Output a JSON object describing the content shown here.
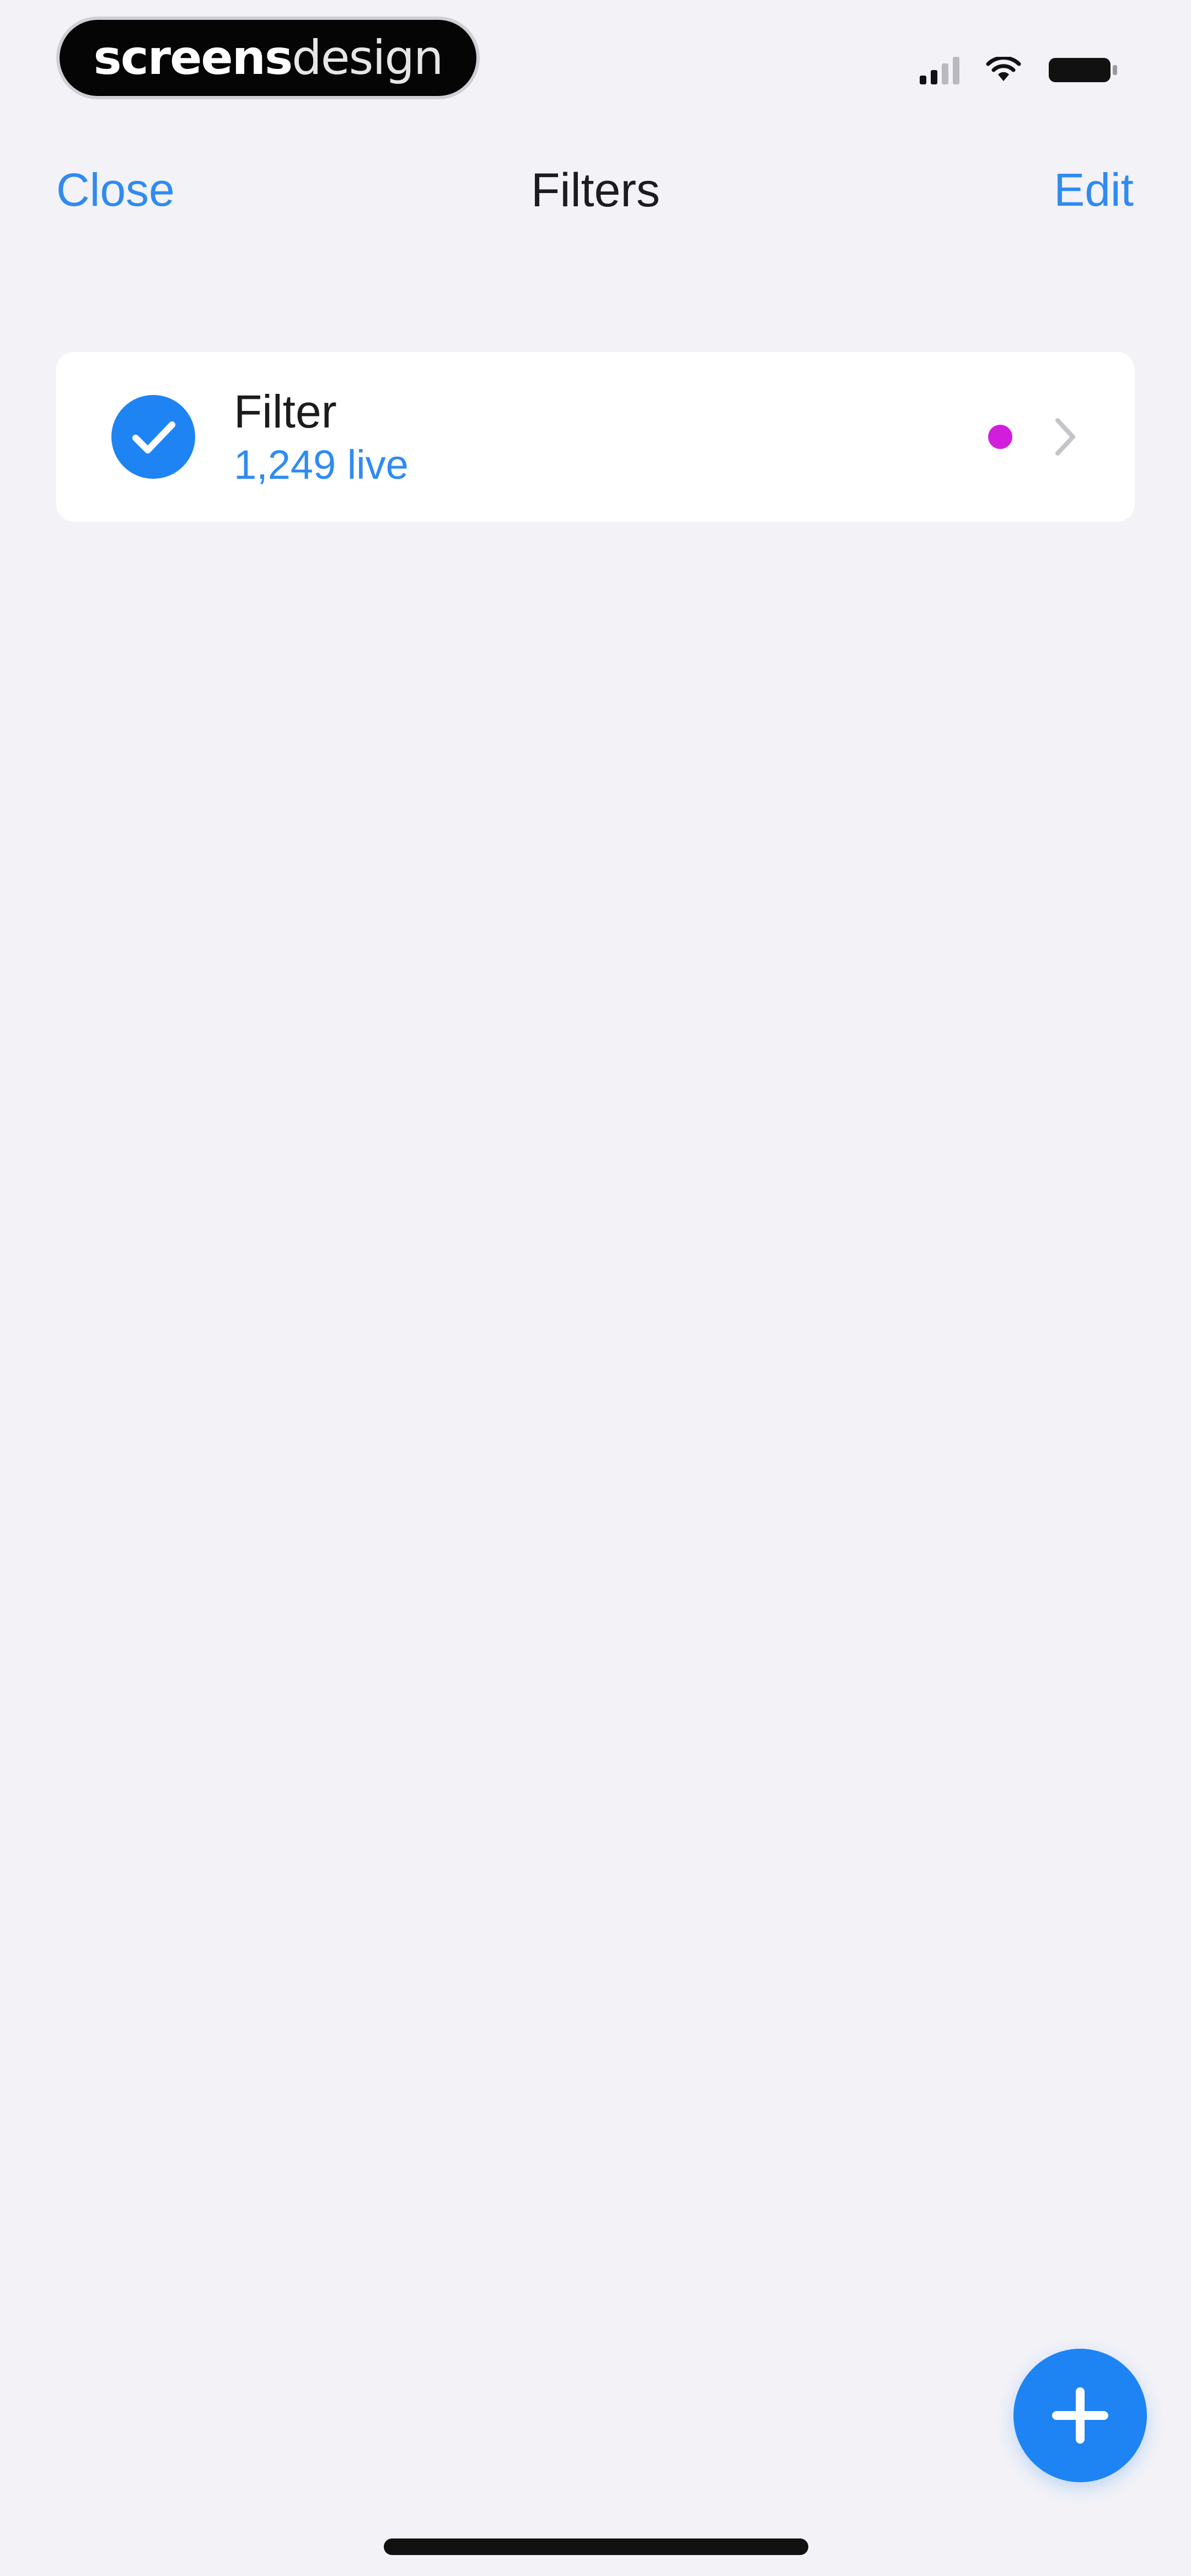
{
  "status_bar": {
    "brand_bold": "screens",
    "brand_light": "design",
    "icons": [
      "cellular-signal-icon",
      "wifi-icon",
      "battery-icon"
    ]
  },
  "nav": {
    "close_label": "Close",
    "title": "Filters",
    "edit_label": "Edit"
  },
  "filters": [
    {
      "name": "Filter",
      "count_label": "1,249 live",
      "selected": true,
      "dot_color": "#D21EDC"
    }
  ],
  "colors": {
    "accent": "#2F8BF0",
    "background": "#F2F2F7",
    "fab": "#1E84F4"
  },
  "fab": {
    "icon": "plus-icon"
  }
}
